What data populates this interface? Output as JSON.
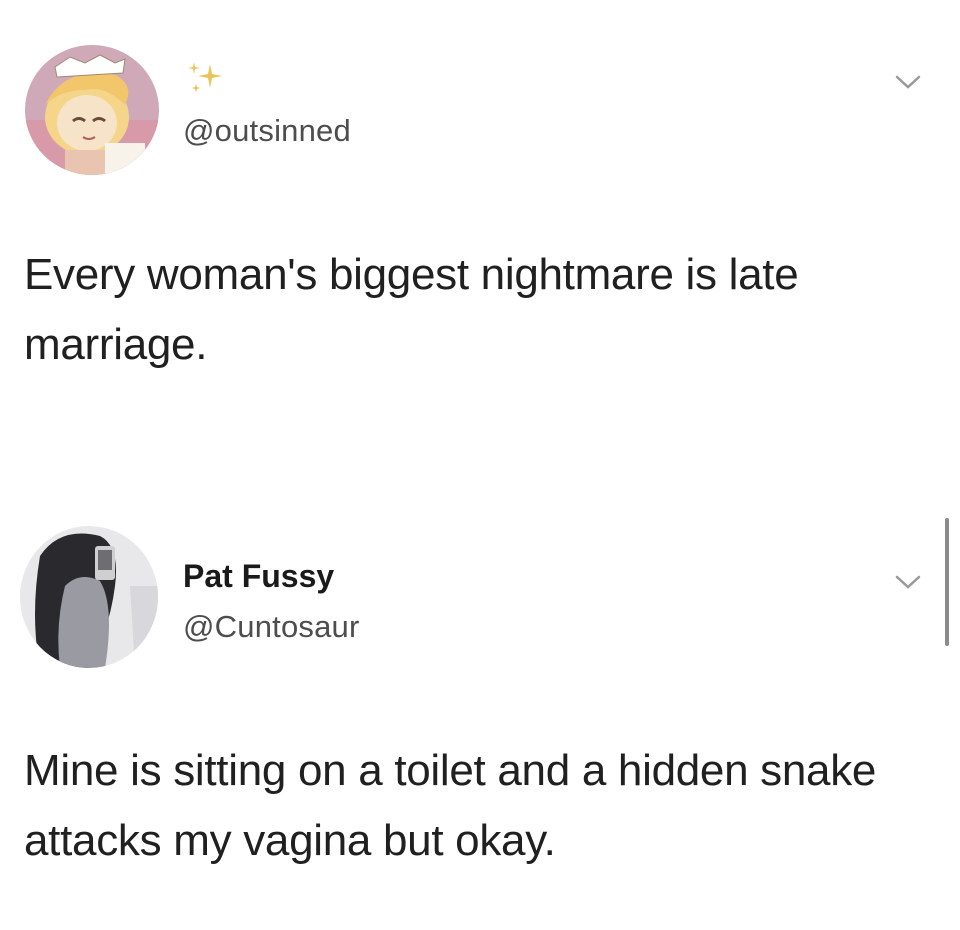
{
  "tweets": [
    {
      "display_name": "",
      "handle": "@outsinned",
      "text": "Every woman's biggest nightmare is late marriage.",
      "avatar_icon": "cartoon-avatar-icon",
      "has_sparkle": true
    },
    {
      "display_name": "Pat Fussy",
      "handle": "@Cuntosaur",
      "text": "Mine is sitting on a toilet and a hidden snake attacks my vagina but okay.",
      "avatar_icon": "photo-avatar-icon"
    }
  ],
  "colors": {
    "background": "#ffffff",
    "text": "#202020",
    "handle": "#4d4d4d",
    "chevron": "#9a9a9a",
    "sparkle": "#e8c45a"
  }
}
